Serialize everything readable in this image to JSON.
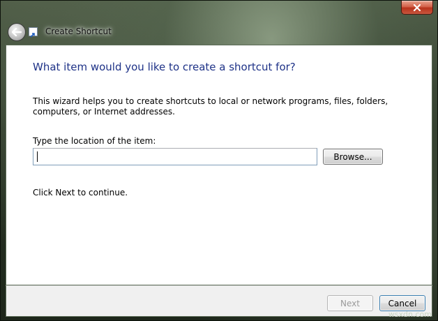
{
  "window": {
    "title": "Create Shortcut"
  },
  "page": {
    "heading": "What item would you like to create a shortcut for?",
    "description": "This wizard helps you to create shortcuts to local or network programs, files, folders, computers, or Internet addresses.",
    "location_label": "Type the location of the item:",
    "location_value": "",
    "browse_label": "Browse...",
    "continue_text": "Click Next to continue."
  },
  "footer": {
    "next_label": "Next",
    "cancel_label": "Cancel"
  },
  "watermark": "wsxdn.com",
  "icons": {
    "close": "close-icon",
    "back": "back-arrow-icon",
    "shortcut": "shortcut-icon"
  },
  "colors": {
    "heading": "#1e3287",
    "close_button": "#c7432b",
    "frame": "#2b3527"
  }
}
